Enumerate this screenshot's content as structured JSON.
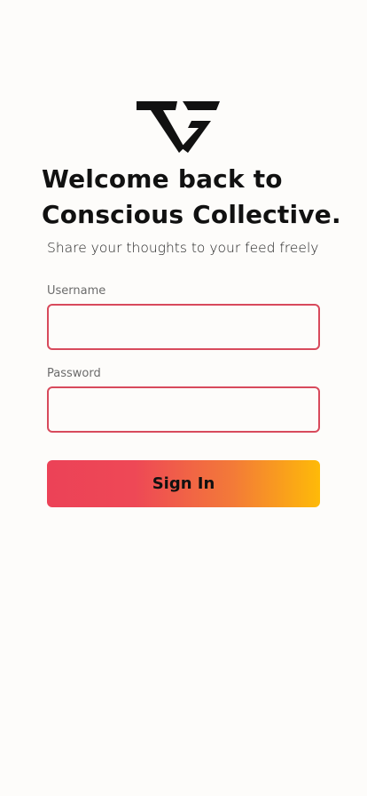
{
  "app": {
    "logo_icon": "vg-monogram-logo"
  },
  "welcome": {
    "title_line1": "Welcome back to",
    "title_line2": "Conscious Collective.",
    "subtitle": "Share your thoughts to your feed freely"
  },
  "form": {
    "username": {
      "label": "Username",
      "value": ""
    },
    "password": {
      "label": "Password",
      "value": ""
    },
    "submit_label": "Sign In"
  },
  "colors": {
    "background": "#fdfcfa",
    "text": "#111111",
    "input_border": "#d84a5c",
    "button_gradient_start": "#ec4257",
    "button_gradient_end": "#feba08"
  }
}
